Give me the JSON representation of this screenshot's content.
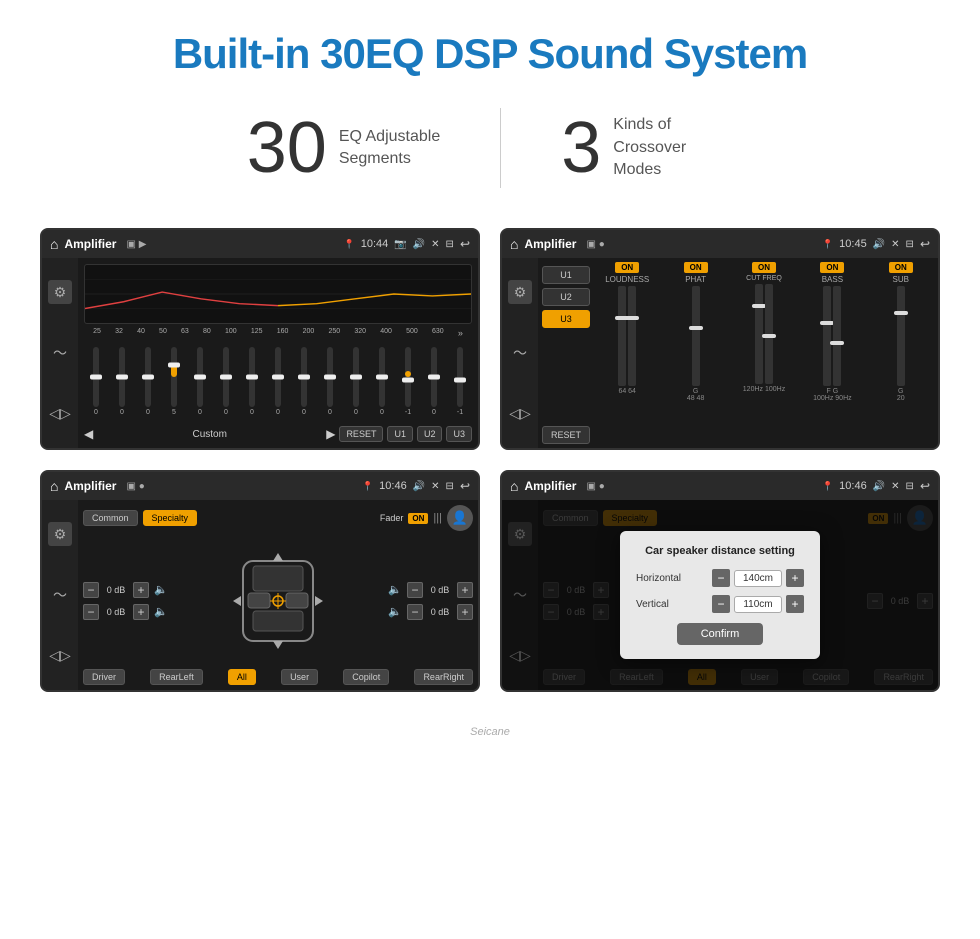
{
  "page": {
    "title": "Built-in 30EQ DSP Sound System",
    "stats": [
      {
        "number": "30",
        "desc": "EQ Adjustable\nSegments"
      },
      {
        "number": "3",
        "desc": "Kinds of\nCrossover Modes"
      }
    ]
  },
  "screens": [
    {
      "id": "screen-1",
      "time": "10:44",
      "title": "Amplifier",
      "type": "eq",
      "freqs": [
        "25",
        "32",
        "40",
        "50",
        "63",
        "80",
        "100",
        "125",
        "160",
        "200",
        "250",
        "320",
        "400",
        "500",
        "630"
      ],
      "values": [
        "0",
        "0",
        "0",
        "5",
        "0",
        "0",
        "0",
        "0",
        "0",
        "0",
        "0",
        "0",
        "-1",
        "0",
        "-1"
      ],
      "bottom": {
        "preset": "Custom",
        "buttons": [
          "RESET",
          "U1",
          "U2",
          "U3"
        ]
      }
    },
    {
      "id": "screen-2",
      "time": "10:45",
      "title": "Amplifier",
      "type": "crossover",
      "channels": [
        "LOUDNESS",
        "PHAT",
        "CUT FREQ",
        "BASS",
        "SUB"
      ],
      "userBtns": [
        "U1",
        "U2",
        "U3"
      ]
    },
    {
      "id": "screen-3",
      "time": "10:46",
      "title": "Amplifier",
      "type": "amplifier",
      "modeBtns": [
        "Common",
        "Specialty"
      ],
      "faderLabel": "Fader",
      "faderState": "ON",
      "dbValues": [
        "0 dB",
        "0 dB",
        "0 dB",
        "0 dB"
      ],
      "zoneBtns": [
        "Driver",
        "RearLeft",
        "All",
        "User",
        "Copilot",
        "RearRight"
      ]
    },
    {
      "id": "screen-4",
      "time": "10:46",
      "title": "Amplifier",
      "type": "amplifier-dialog",
      "modeBtns": [
        "Common",
        "Specialty"
      ],
      "dialog": {
        "title": "Car speaker distance setting",
        "rows": [
          {
            "label": "Horizontal",
            "value": "140cm"
          },
          {
            "label": "Vertical",
            "value": "110cm"
          }
        ],
        "confirmLabel": "Confirm"
      },
      "dbValues": [
        "0 dB",
        "0 dB"
      ],
      "zoneBtns": [
        "Driver",
        "RearLeft",
        "All",
        "User",
        "Copilot",
        "RearRight"
      ]
    }
  ],
  "watermark": "Seicane"
}
